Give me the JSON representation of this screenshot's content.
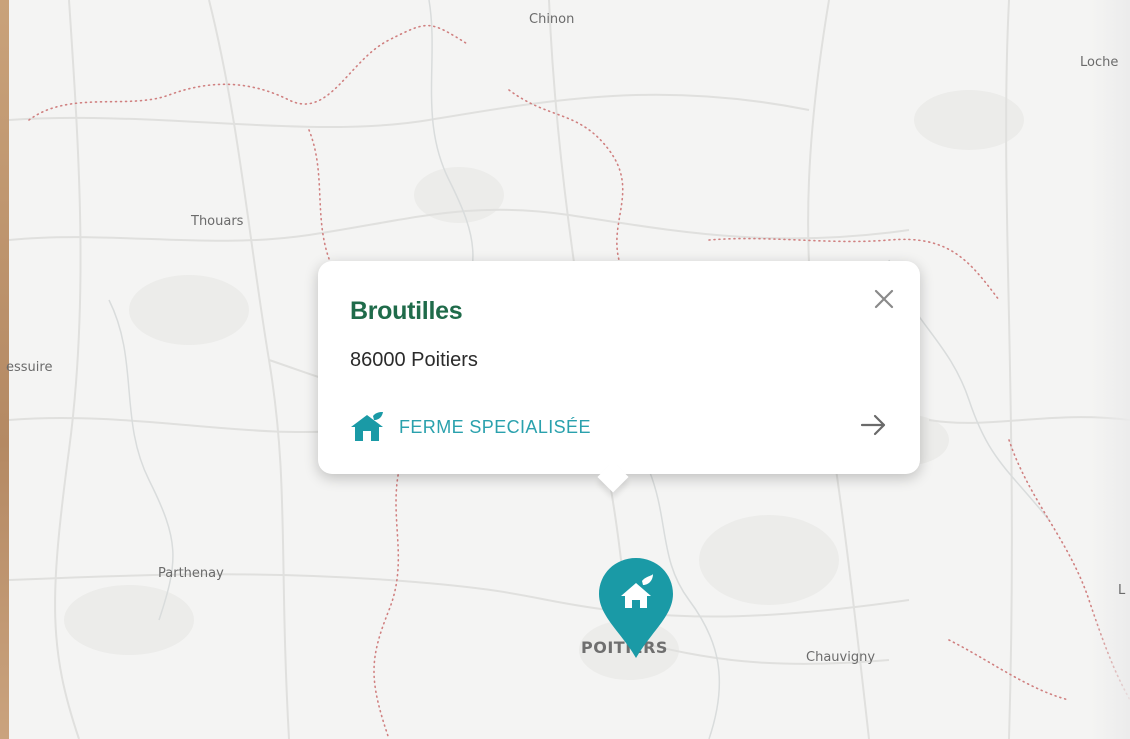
{
  "map": {
    "places": {
      "chinon": "Chinon",
      "loches": "Loche",
      "thouars": "Thouars",
      "bressuire": "essuire",
      "parthenay": "Parthenay",
      "poitiers": "POITIERS",
      "chauvigny": "Chauvigny",
      "edge_l": "L"
    }
  },
  "popup": {
    "title": "Broutilles",
    "address": "86000 Poitiers",
    "category": "FERME SPECIALISÉE",
    "category_icon": "farm-house-icon",
    "close_icon": "close-icon",
    "arrow_icon": "arrow-right-icon"
  },
  "marker": {
    "icon": "farm-house-icon",
    "color": "#1a9aa6"
  },
  "colors": {
    "title": "#1f6b4a",
    "accent": "#2aa1ad",
    "marker": "#1a9aa6",
    "map_bg": "#f4f4f3",
    "boundary": "#d08080"
  }
}
